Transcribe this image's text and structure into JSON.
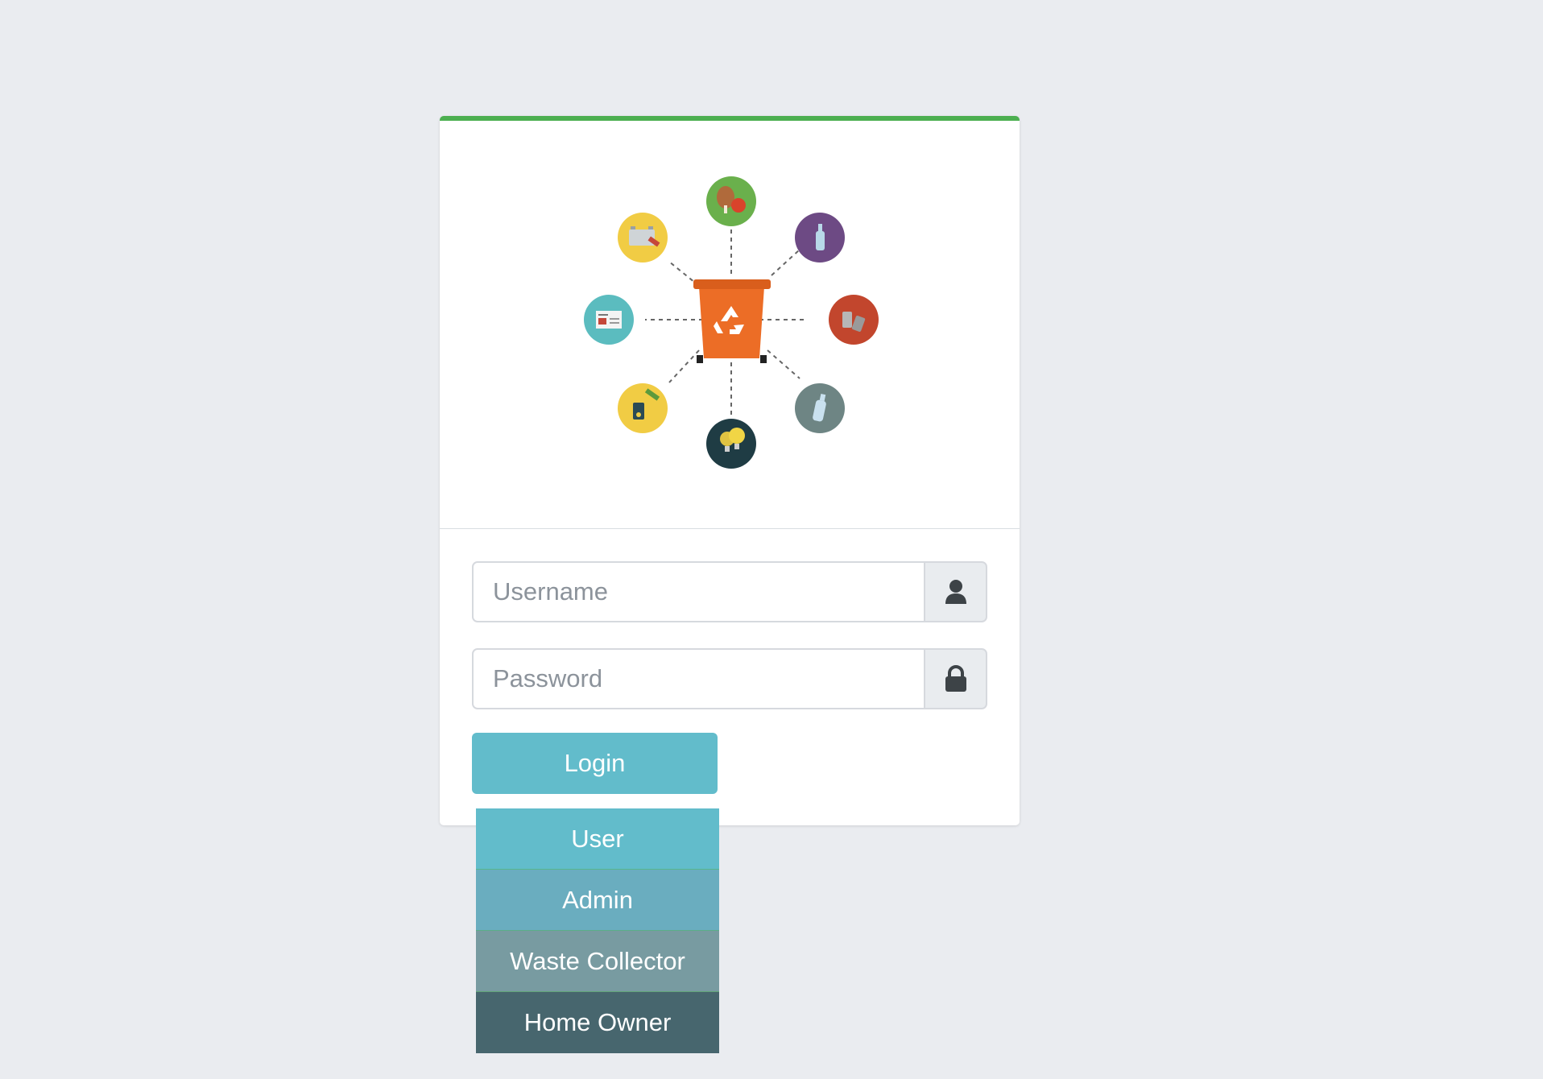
{
  "login_form": {
    "username_placeholder": "Username",
    "password_placeholder": "Password",
    "username_icon": "user-icon",
    "password_icon": "lock-icon",
    "login_label": "Login"
  },
  "role_menu": {
    "items": [
      {
        "label": "User",
        "color": "#62bccb"
      },
      {
        "label": "Admin",
        "color": "#6aadbf"
      },
      {
        "label": "Waste Collector",
        "color": "#789ba1"
      },
      {
        "label": "Home Owner",
        "color": "#47666e"
      }
    ]
  },
  "colors": {
    "accent_top_border": "#4caf50",
    "login_button": "#62bccb",
    "recycle_bin": "#ec6d26",
    "background": "#eaecf0"
  },
  "logo": {
    "center_icon": "recycle-bin-icon",
    "satellites": [
      {
        "icon": "organic-waste-icon",
        "color": "#6ab04c"
      },
      {
        "icon": "glass-bottle-icon",
        "color": "#6d4a84"
      },
      {
        "icon": "metal-cans-icon",
        "color": "#c2462d"
      },
      {
        "icon": "plastic-bottle-icon",
        "color": "#6e8584"
      },
      {
        "icon": "light-bulb-icon",
        "color": "#1f3c44"
      },
      {
        "icon": "electronics-icon",
        "color": "#f1cc44"
      },
      {
        "icon": "newspaper-icon",
        "color": "#5bbcbf"
      },
      {
        "icon": "battery-icon",
        "color": "#f1cc44"
      }
    ]
  }
}
